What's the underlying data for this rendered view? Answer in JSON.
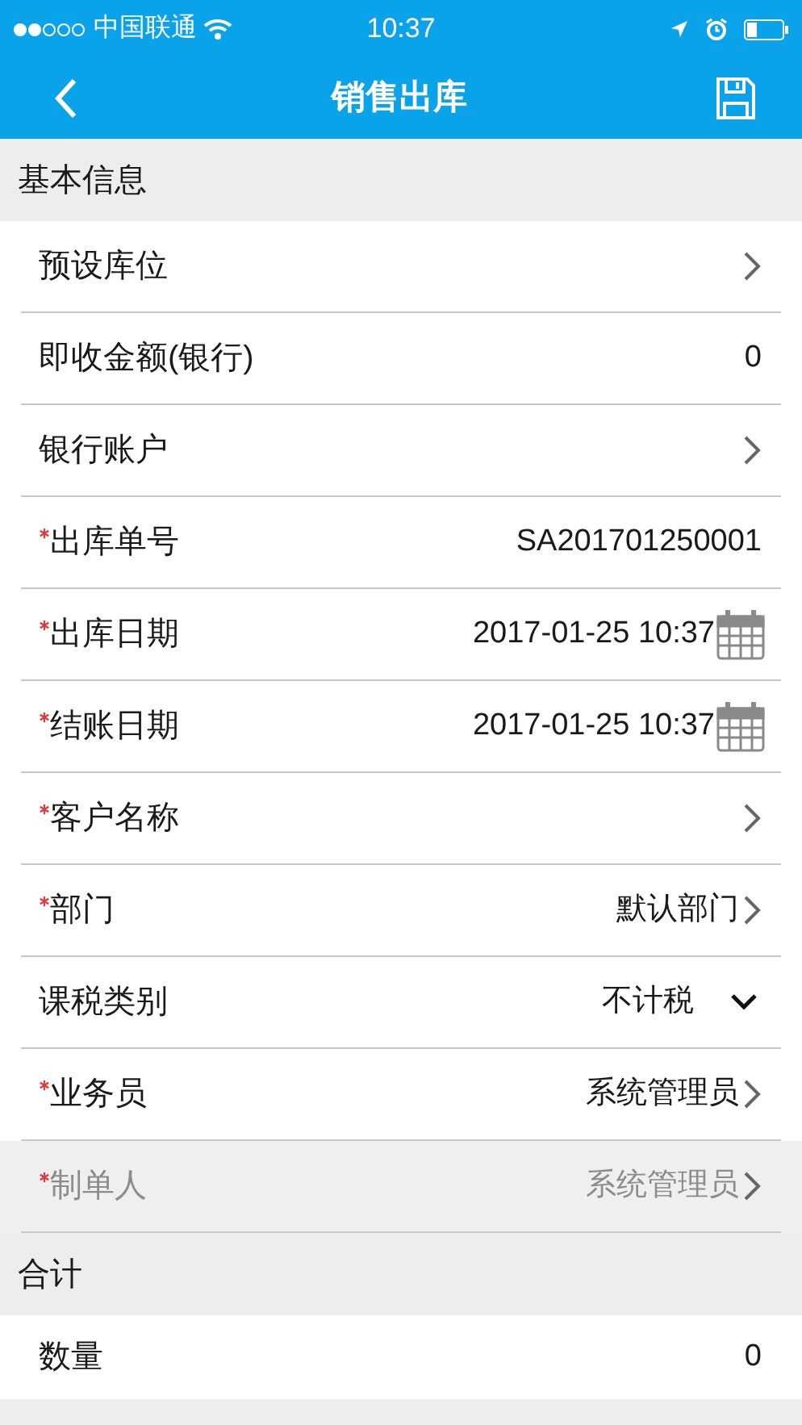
{
  "status_bar": {
    "carrier": "中国联通",
    "time": "10:37"
  },
  "nav": {
    "title": "销售出库"
  },
  "sections": [
    {
      "title": "基本信息",
      "rows": [
        {
          "label": "预设库位",
          "kind": "chevron",
          "required": false,
          "disabled": false
        },
        {
          "label": "即收金额(银行)",
          "kind": "value",
          "value": "0",
          "required": false,
          "disabled": false
        },
        {
          "label": "银行账户",
          "kind": "chevron",
          "required": false,
          "disabled": false
        },
        {
          "label": "出库单号",
          "kind": "value",
          "value": "SA201701250001",
          "required": true,
          "disabled": false
        },
        {
          "label": "出库日期",
          "kind": "date",
          "value": "2017-01-25 10:37",
          "required": true,
          "disabled": false
        },
        {
          "label": "结账日期",
          "kind": "date",
          "value": "2017-01-25 10:37",
          "required": true,
          "disabled": false
        },
        {
          "label": "客户名称",
          "kind": "chevron",
          "required": true,
          "disabled": false
        },
        {
          "label": "部门",
          "kind": "chevron",
          "value": "默认部门",
          "required": true,
          "disabled": false
        },
        {
          "label": "课税类别",
          "kind": "dropdown",
          "value": "不计税",
          "required": false,
          "disabled": false
        },
        {
          "label": "业务员",
          "kind": "chevron",
          "value": "系统管理员",
          "required": true,
          "disabled": false
        },
        {
          "label": "制单人",
          "kind": "chevron",
          "value": "系统管理员",
          "required": true,
          "disabled": true
        }
      ]
    },
    {
      "title": "合计",
      "rows": [
        {
          "label": "数量",
          "kind": "value",
          "value": "0",
          "required": false,
          "disabled": false
        }
      ]
    }
  ]
}
